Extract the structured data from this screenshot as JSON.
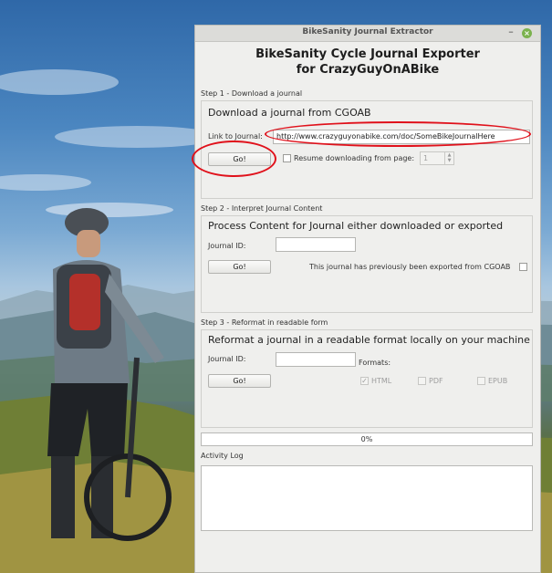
{
  "window": {
    "title": "BikeSanity Journal Extractor",
    "minimize_glyph": "–",
    "close_glyph": "×",
    "close_color": "#7bb24e"
  },
  "app": {
    "title_line1": "BikeSanity Cycle Journal Exporter",
    "title_line2": "for CrazyGuyOnABike"
  },
  "step1": {
    "label": "Step 1 - Download a journal",
    "heading": "Download a journal from CGOAB",
    "link_label": "Link to Journal:",
    "link_value": "http://www.crazyguyonabike.com/doc/SomeBikeJournalHere",
    "go_label": "Go!",
    "resume_label": "Resume downloading from page:",
    "resume_checked": false,
    "resume_page": "1"
  },
  "step2": {
    "label": "Step 2 - Interpret Journal Content",
    "heading": "Process Content for Journal either downloaded or exported",
    "journal_id_label": "Journal ID:",
    "journal_id_value": "",
    "go_label": "Go!",
    "exported_label": "This journal has previously been exported from CGOAB",
    "exported_checked": false
  },
  "step3": {
    "label": "Step 3 - Reformat in readable form",
    "heading": "Reformat a journal in a readable format locally on your machine",
    "journal_id_label": "Journal ID:",
    "journal_id_value": "",
    "go_label": "Go!",
    "formats_label": "Formats:",
    "formats": [
      {
        "label": "HTML",
        "checked": true,
        "enabled": false
      },
      {
        "label": "PDF",
        "checked": false,
        "enabled": false
      },
      {
        "label": "EPUB",
        "checked": false,
        "enabled": false
      }
    ]
  },
  "progress": {
    "text": "0%",
    "value": 0
  },
  "activity_log": {
    "label": "Activity Log",
    "content": ""
  },
  "annotations": {
    "highlight_color": "#e0111b"
  }
}
